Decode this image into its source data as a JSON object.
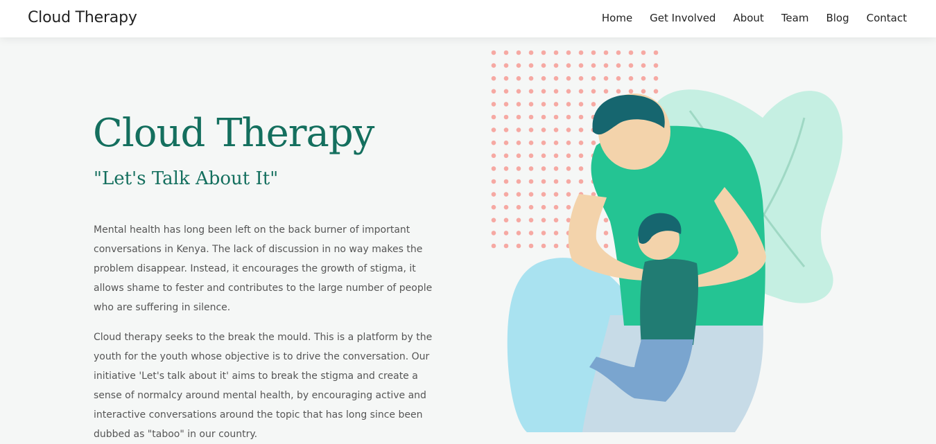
{
  "navbar": {
    "brand": "Cloud Therapy",
    "links": [
      "Home",
      "Get Involved",
      "About",
      "Team",
      "Blog",
      "Contact"
    ]
  },
  "hero": {
    "title": "Cloud Therapy",
    "subtitle": "\"Let's Talk About It\"",
    "paragraphs": [
      "Mental health has long been left on the back burner of important conversations in Kenya. The lack of discussion in no way makes the problem disappear. Instead, it encourages the growth of stigma, it allows shame to fester and contributes to the large number of people who are suffering in silence.",
      "Cloud therapy seeks to the break the mould. This is a platform by the youth for the youth whose objective is to drive the conversation. Our initiative 'Let's talk about it' aims to break the stigma and create a sense of normalcy around mental health, by encouraging active and interactive conversations around the topic that has long since been dubbed as \"taboo\" in our country."
    ]
  },
  "colors": {
    "accent": "#146f5e",
    "shirt": "#25c596",
    "dots": "#f6a9a3",
    "blob_mint": "#bfeee0",
    "blob_blue": "#a8e3f2"
  }
}
